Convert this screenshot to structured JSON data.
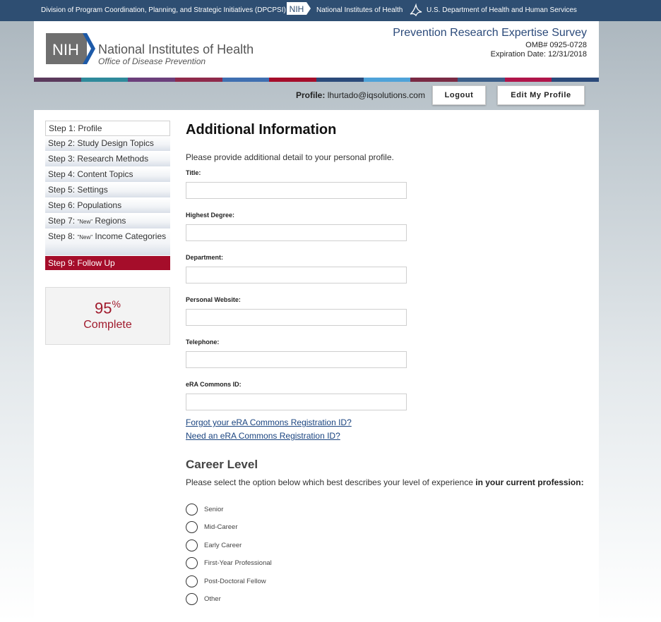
{
  "topbar": {
    "division": "Division of Program Coordination, Planning, and Strategic Initiatives (DPCPSI)",
    "nih_badge": "NIH",
    "nih": "National Institutes of Health",
    "hhs": "U.S. Department of Health and Human Services"
  },
  "header": {
    "logo_text": "NIH",
    "org_name": "National Institutes of Health",
    "org_sub": "Office of Disease Prevention",
    "survey_title": "Prevention Research Expertise Survey",
    "omb": "OMB# 0925-0728",
    "expiration": "Expiration Date: 12/31/2018"
  },
  "colors": {
    "topbar": "#2e4e72",
    "accent_red": "#a50d2a",
    "link": "#1a4480",
    "stripe": [
      "#5b3a5c",
      "#2f8a9b",
      "#6b3f7b",
      "#8f2a4b",
      "#3f6fb1",
      "#a50d2a",
      "#2b4a7a",
      "#4fa3d9",
      "#7a2a44",
      "#3b5f8a",
      "#b0154a",
      "#2b4a7a"
    ]
  },
  "profile": {
    "label": "Profile:",
    "email": "lhurtado@iqsolutions.com",
    "logout": "Logout",
    "edit": "Edit My Profile"
  },
  "steps": [
    {
      "label": "Step 1: Profile"
    },
    {
      "label": "Step 2: Study Design Topics"
    },
    {
      "label": "Step 3: Research Methods"
    },
    {
      "label": "Step 4: Content Topics"
    },
    {
      "label": "Step 5: Settings"
    },
    {
      "label": "Step 6: Populations"
    },
    {
      "prefix": "Step 7: ",
      "new": "\"New\"",
      "label": " Regions"
    },
    {
      "prefix": "Step 8: ",
      "new": "\"New\"",
      "label": " Income Categories"
    },
    {
      "label": "Step 9: Follow Up"
    }
  ],
  "progress": {
    "percent_value": 95,
    "percent": "95",
    "symbol": "%",
    "label": "Complete"
  },
  "form": {
    "title": "Additional Information",
    "intro": "Please provide additional detail to your personal profile.",
    "fields": [
      {
        "label": "Title:",
        "value": ""
      },
      {
        "label": "Highest Degree:",
        "value": ""
      },
      {
        "label": "Department:",
        "value": ""
      },
      {
        "label": "Personal Website:",
        "value": ""
      },
      {
        "label": "Telephone:",
        "value": ""
      },
      {
        "label": "eRA Commons ID:",
        "value": ""
      }
    ],
    "link_forgot": "Forgot your eRA Commons Registration ID?",
    "link_need": "Need an eRA Commons Registration ID?"
  },
  "career": {
    "title": "Career Level",
    "desc": "Please select the option below which best describes your level of experience ",
    "desc_bold": "in your current profession:",
    "options": [
      "Senior",
      "Mid-Career",
      "Early Career",
      "First-Year Professional",
      "Post-Doctoral Fellow",
      "Other"
    ]
  }
}
